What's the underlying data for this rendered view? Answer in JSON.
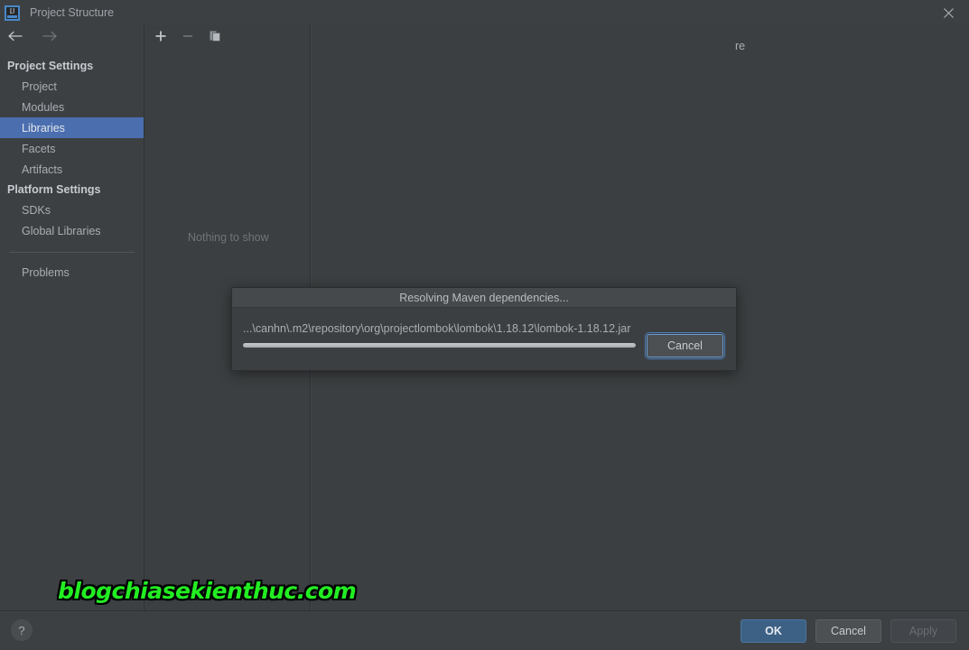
{
  "window": {
    "title": "Project Structure",
    "logo_icon": "intellij-idea-icon",
    "close_icon": "close-icon"
  },
  "nav": {
    "back_icon": "arrow-left-icon",
    "forward_icon": "arrow-right-icon"
  },
  "sidebar": {
    "groups": [
      {
        "header": "Project Settings",
        "items": [
          {
            "label": "Project",
            "selected": false
          },
          {
            "label": "Modules",
            "selected": false
          },
          {
            "label": "Libraries",
            "selected": true
          },
          {
            "label": "Facets",
            "selected": false
          },
          {
            "label": "Artifacts",
            "selected": false
          }
        ]
      },
      {
        "header": "Platform Settings",
        "items": [
          {
            "label": "SDKs",
            "selected": false
          },
          {
            "label": "Global Libraries",
            "selected": false
          }
        ]
      }
    ],
    "footer_item": {
      "label": "Problems"
    }
  },
  "middle_panel": {
    "toolbar": [
      {
        "name": "add-icon",
        "glyph": "+",
        "enabled": true
      },
      {
        "name": "remove-icon",
        "glyph": "−",
        "enabled": false
      },
      {
        "name": "copy-icon",
        "glyph": "copy",
        "enabled": true
      }
    ],
    "empty_text": "Nothing to show"
  },
  "right_panel": {
    "obscured_text_fragment": "re"
  },
  "dialog": {
    "title": "Resolving Maven dependencies...",
    "path": "...\\canhn\\.m2\\repository\\org\\projectlombok\\lombok\\1.18.12\\lombok-1.18.12.jar",
    "cancel_label": "Cancel",
    "progress_indeterminate": true
  },
  "bottom_bar": {
    "help_label": "?",
    "buttons": [
      {
        "label": "OK",
        "style": "primary",
        "enabled": true
      },
      {
        "label": "Cancel",
        "style": "normal",
        "enabled": true
      },
      {
        "label": "Apply",
        "style": "disabled",
        "enabled": false
      }
    ]
  },
  "watermark": {
    "text": "blogchiasekienthuc.com",
    "color": "#22ee22"
  }
}
